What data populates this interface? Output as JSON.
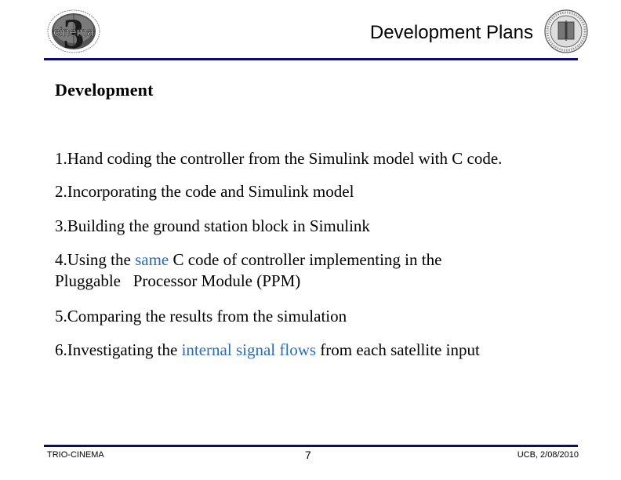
{
  "header": {
    "title": "Development Plans",
    "left_logo": {
      "name": "cinema-3-logo",
      "text": "cinema"
    },
    "right_logo": {
      "name": "uc-seal"
    }
  },
  "body": {
    "heading": "Development",
    "items": [
      {
        "parts": [
          {
            "text": "1.Hand coding the controller from the Simulink model with C code.",
            "highlight": false
          }
        ]
      },
      {
        "parts": [
          {
            "text": "2.Incorporating the code and Simulink model",
            "highlight": false
          }
        ]
      },
      {
        "parts": [
          {
            "text": "3.Building the ground station block in Simulink",
            "highlight": false
          }
        ]
      },
      {
        "parts": [
          {
            "text": "4.Using the ",
            "highlight": false
          },
          {
            "text": "same",
            "highlight": true
          },
          {
            "text": " C code of controller implementing in the",
            "highlight": false
          }
        ],
        "line2": "Pluggable   Processor Module (PPM)"
      },
      {
        "parts": [
          {
            "text": "5.Comparing the results from the simulation",
            "highlight": false
          }
        ]
      },
      {
        "parts": [
          {
            "text": "6.Investigating the ",
            "highlight": false
          },
          {
            "text": "internal signal flows",
            "highlight": true
          },
          {
            "text": " from each satellite input",
            "highlight": false
          }
        ]
      }
    ]
  },
  "footer": {
    "left": "TRIO-CINEMA",
    "page_number": "7",
    "right": "UCB, 2/08/2010"
  },
  "colors": {
    "rule": "#0c0c70",
    "highlight": "#2a6bbb"
  }
}
